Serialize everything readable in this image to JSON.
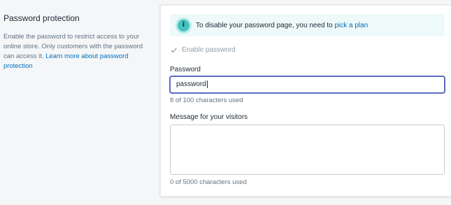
{
  "section": {
    "title": "Password protection",
    "description_text": "Enable the password to restrict access to your online store. Only customers with the password can access it. ",
    "learn_more_link": "Learn more about password protection"
  },
  "banner": {
    "icon": "info-icon",
    "icon_glyph": "i",
    "text": "To disable your password page, you need to ",
    "link": "pick a plan"
  },
  "enable_password": {
    "label": "Enable password",
    "checked": true,
    "disabled": true
  },
  "password": {
    "label": "Password",
    "value": "password",
    "help": "8 of 100 characters used"
  },
  "message": {
    "label": "Message for your visitors",
    "value": "",
    "help": "0 of 5000 characters used"
  },
  "colors": {
    "accent": "#5c6ac4",
    "link": "#006fbb",
    "banner_bg": "#eef9f9",
    "banner_icon": "#47c1bf"
  }
}
